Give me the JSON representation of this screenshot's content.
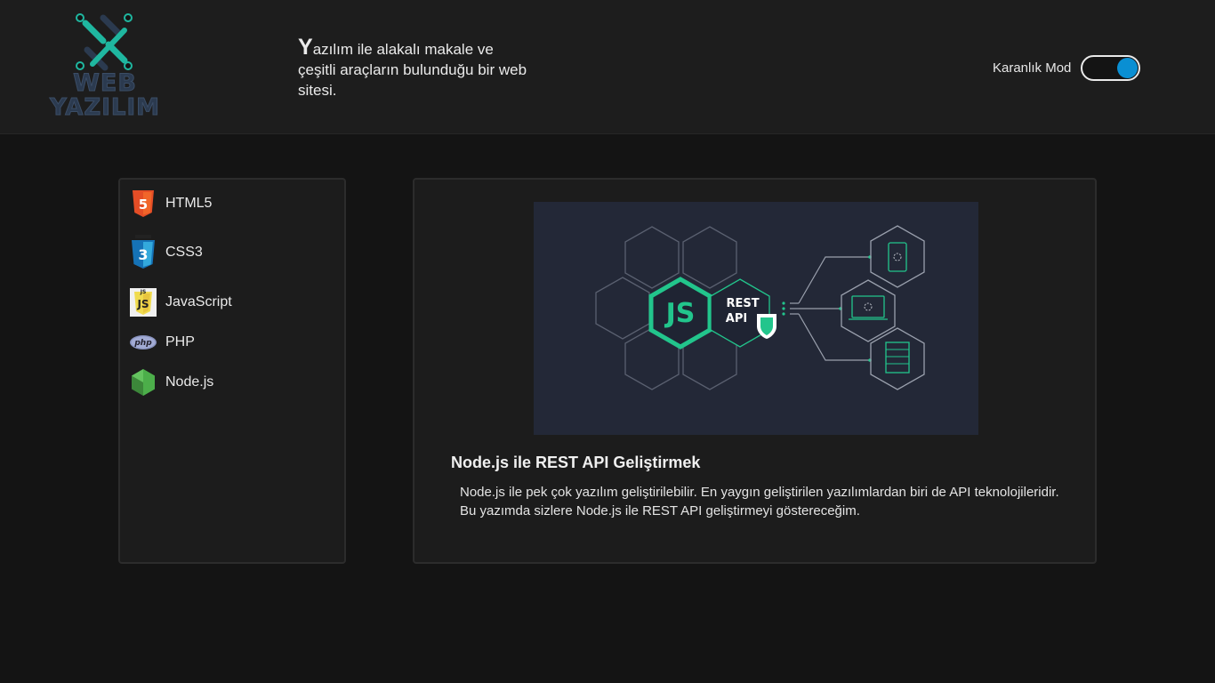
{
  "brand": {
    "logo_line1": "WEB",
    "logo_line2": "YAZILIM",
    "accent_colors": [
      "#1fb7a0",
      "#2b3a4f"
    ]
  },
  "header": {
    "tagline_first_letter": "Y",
    "tagline_rest": "azılım ile alakalı makale ve çeşitli araçların bulunduğu bir web sitesi.",
    "theme_toggle": {
      "label": "Karanlık Mod",
      "state": "on",
      "knob_color": "#0a8fd3"
    }
  },
  "sidebar": {
    "items": [
      {
        "label": "HTML5",
        "icon": "html5-icon"
      },
      {
        "label": "CSS3",
        "icon": "css3-icon"
      },
      {
        "label": "JavaScript",
        "icon": "javascript-icon"
      },
      {
        "label": "PHP",
        "icon": "php-icon"
      },
      {
        "label": "Node.js",
        "icon": "nodejs-icon"
      }
    ]
  },
  "article": {
    "image": {
      "description_icon": "nodejs-rest-api-illustration",
      "badge_text_1": "REST",
      "badge_text_2": "API",
      "js_text": "JS"
    },
    "title": "Node.js ile REST API Geliştirmek",
    "summary": "Node.js ile pek çok yazılım geliştirilebilir. En yaygın geliştirilen yazılımlardan biri de API teknolojileridir. Bu yazımda sizlere Node.js ile REST API geliştirmeyi göstereceğim."
  }
}
